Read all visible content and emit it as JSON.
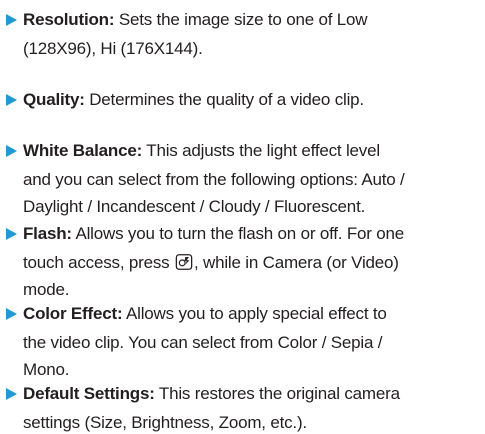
{
  "items": [
    {
      "term": "Resolution:",
      "lines": [
        " Sets the image size to one of Low",
        "(128X96), Hi (176X144)."
      ]
    },
    {
      "term": "Quality:",
      "lines": [
        " Determines the quality of a video clip."
      ]
    },
    {
      "term": "White Balance:",
      "lines": [
        " This adjusts the light effect level",
        "and you can select from the following options: Auto /",
        "Daylight / Incandescent / Cloudy / Fluorescent."
      ]
    },
    {
      "term": "Flash:",
      "lines": [
        " Allows you to turn the flash on or off.  For one",
        "touch access, press ",
        ", while in Camera (or Video)",
        "mode."
      ]
    },
    {
      "term": "Color Effect:",
      "lines": [
        " Allows you to apply special effect to",
        "the video clip. You can select from Color / Sepia /",
        "Mono."
      ]
    },
    {
      "term": "Default Settings:",
      "lines": [
        " This restores the original camera",
        "settings (Size, Brightness, Zoom, etc.)."
      ]
    }
  ],
  "colors": {
    "bullet": "#1e9ad6",
    "text": "#231f20"
  },
  "icons": {
    "flash_key": "camera-flash-key-icon"
  }
}
